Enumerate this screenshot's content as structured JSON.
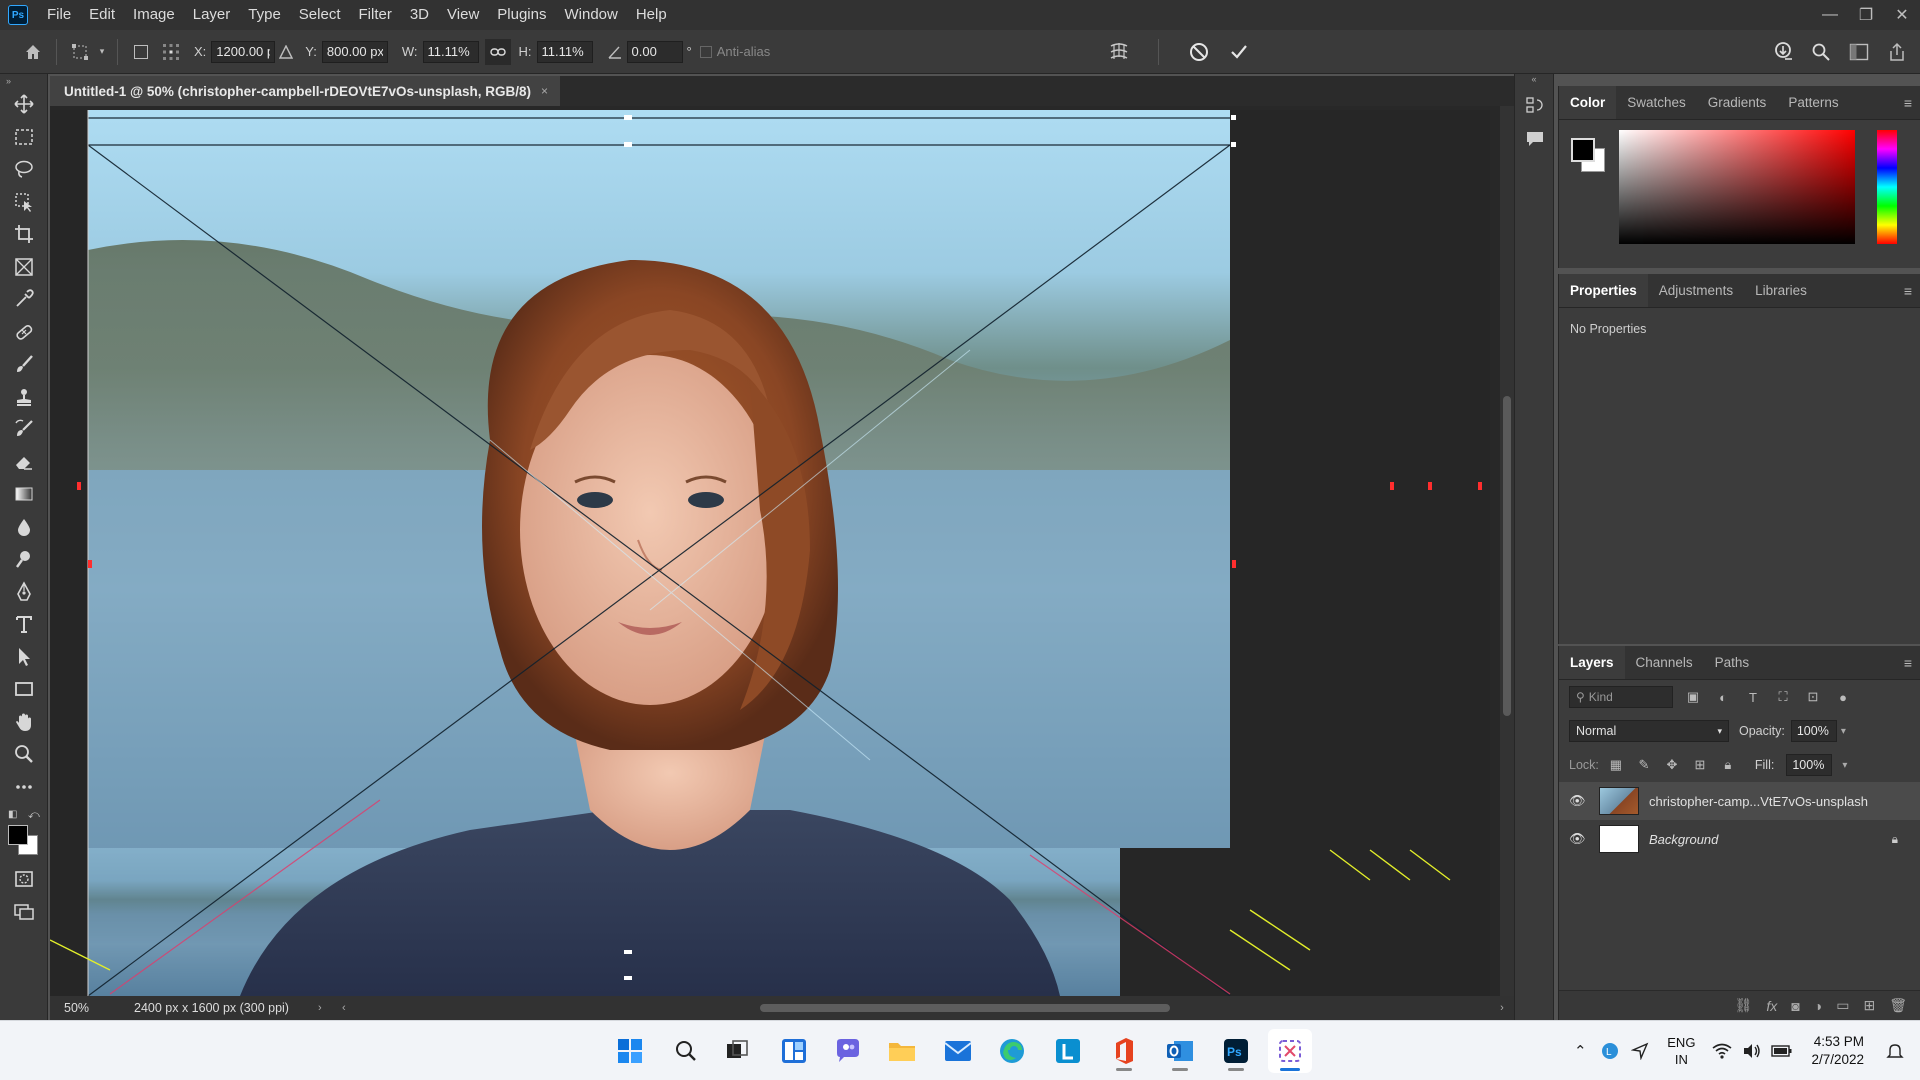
{
  "app": {
    "logo": "Ps"
  },
  "menu": [
    "File",
    "Edit",
    "Image",
    "Layer",
    "Type",
    "Select",
    "Filter",
    "3D",
    "View",
    "Plugins",
    "Window",
    "Help"
  ],
  "window_controls": {
    "minimize": "—",
    "restore": "❐",
    "close": "✕"
  },
  "options": {
    "x_label": "X:",
    "x_value": "1200.00 p",
    "y_label": "Y:",
    "y_value": "800.00 px",
    "w_label": "W:",
    "w_value": "11.11%",
    "h_label": "H:",
    "h_value": "11.11%",
    "angle_value": "0.00",
    "angle_unit": "°",
    "antialias_label": "Anti-alias"
  },
  "document": {
    "tab_title": "Untitled-1 @ 50% (christopher-campbell-rDEOVtE7vOs-unsplash, RGB/8)",
    "tab_close": "×",
    "zoom": "50%",
    "info": "2400 px x 1600 px (300 ppi)"
  },
  "color_panel": {
    "tabs": [
      "Color",
      "Swatches",
      "Gradients",
      "Patterns"
    ],
    "foreground": "#000000",
    "background": "#ffffff"
  },
  "properties_panel": {
    "tabs": [
      "Properties",
      "Adjustments",
      "Libraries"
    ],
    "empty_text": "No Properties"
  },
  "layers_panel": {
    "tabs": [
      "Layers",
      "Channels",
      "Paths"
    ],
    "filter_placeholder": "Kind",
    "blend_mode": "Normal",
    "opacity_label": "Opacity:",
    "opacity_value": "100%",
    "lock_label": "Lock:",
    "fill_label": "Fill:",
    "fill_value": "100%",
    "layers": [
      {
        "name": "christopher-camp...VtE7vOs-unsplash",
        "visible": true,
        "selected": true
      },
      {
        "name": "Background",
        "visible": true,
        "selected": false,
        "locked": true
      }
    ]
  },
  "taskbar": {
    "apps": [
      "windows-start",
      "search",
      "task-view",
      "widgets",
      "chat",
      "file-explorer",
      "mail",
      "edge",
      "app-l",
      "office",
      "outlook",
      "photoshop",
      "snipping-tool"
    ],
    "language_top": "ENG",
    "language_bottom": "IN",
    "time": "4:53 PM",
    "date": "2/7/2022"
  }
}
